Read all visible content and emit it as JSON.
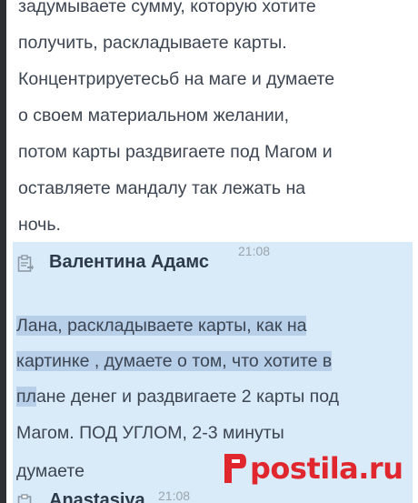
{
  "colors": {
    "selection_background": "#d9ebf8",
    "text_highlight": "#b7cfe9",
    "text": "#3c4551",
    "author": "#2d3a4a",
    "timestamp": "#9aa4ad",
    "watermark": "#e0272d"
  },
  "prev_message": {
    "lines": [
      "задумываете сумму, которую хотите",
      "получить, раскладываете карты.",
      "Концентрируетесьб на маге и думаете",
      "о своем материальном желании,",
      "потом карты раздвигаете под Магом и",
      "оставляете мандалу так лежать на",
      "ночь."
    ]
  },
  "selected_message": {
    "icon": "clipboard-icon",
    "author": "Валентина Адамс",
    "time": "21:08",
    "lines": [
      "Лана, раскладываете карты, как на",
      "картинке , думаете о том, что хотите в",
      "плане денег и раздвигаете 2 карты под",
      "Магом. ПОД УГЛОМ, 2-3 минуты",
      "думаете"
    ],
    "line3_prefix": "пл",
    "line3_rest": "ане денег и раздвигаете 2 карты под"
  },
  "next_message": {
    "icon": "clipboard-icon",
    "author": "Anastasiya",
    "time": "21:08"
  },
  "watermark": {
    "icon": "postila-logo-icon",
    "text_main": "postila",
    "text_tld": ".ru"
  }
}
